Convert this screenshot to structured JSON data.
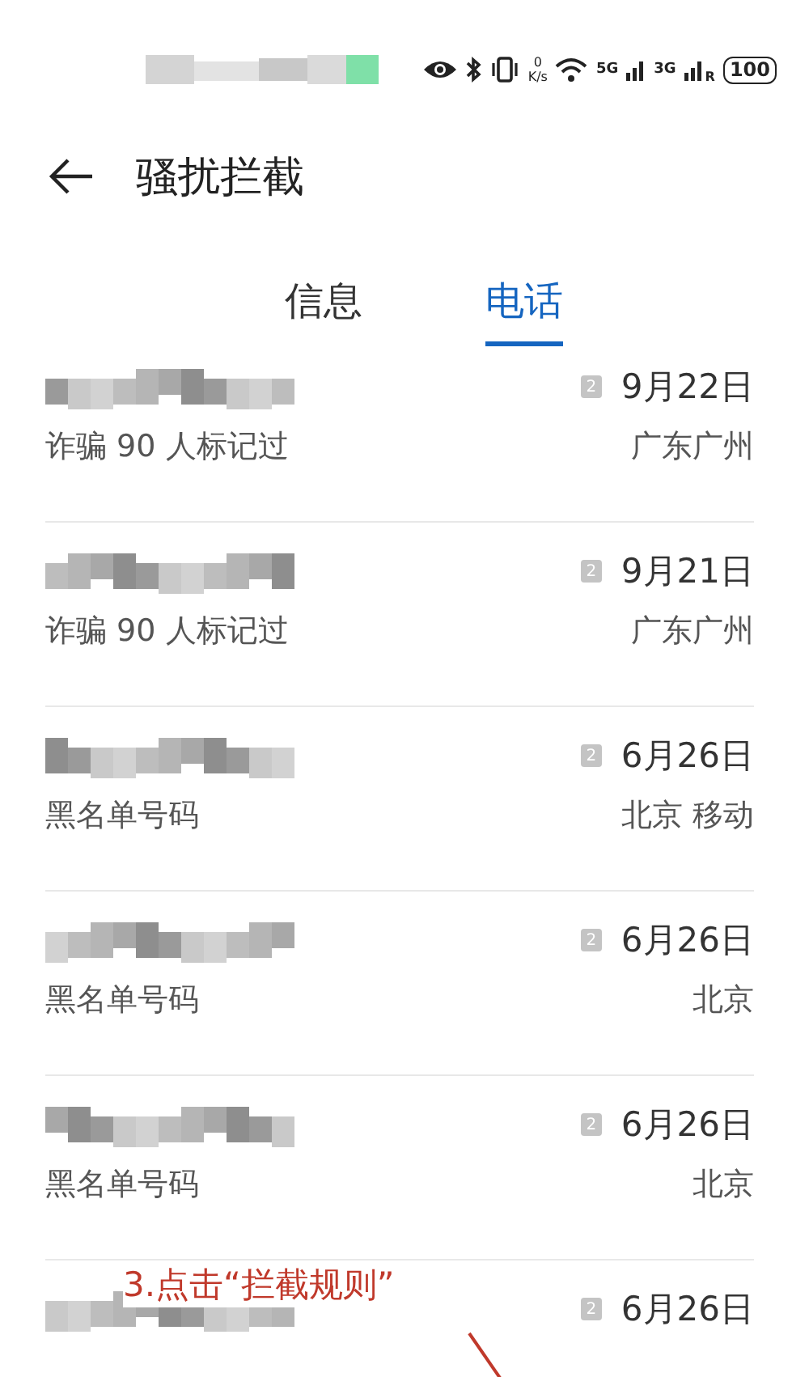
{
  "status_bar": {
    "speed_value": "0",
    "speed_unit": "K/s",
    "network_1": "5G",
    "network_2": "3G",
    "roaming": "R",
    "battery": "100"
  },
  "header": {
    "title": "骚扰拦截"
  },
  "tabs": [
    {
      "label": "信息",
      "selected": false
    },
    {
      "label": "电话",
      "selected": true
    }
  ],
  "calls": [
    {
      "sim": "2",
      "date": "9月22日",
      "label": "诈骗  90 人标记过",
      "location": "广东广州"
    },
    {
      "sim": "2",
      "date": "9月21日",
      "label": "诈骗  90 人标记过",
      "location": "广东广州"
    },
    {
      "sim": "2",
      "date": "6月26日",
      "label": "黑名单号码",
      "location": "北京 移动"
    },
    {
      "sim": "2",
      "date": "6月26日",
      "label": "黑名单号码",
      "location": "北京"
    },
    {
      "sim": "2",
      "date": "6月26日",
      "label": "黑名单号码",
      "location": "北京"
    },
    {
      "sim": "2",
      "date": "6月26日"
    }
  ],
  "annotation": {
    "text": "3.点击“拦截规则”"
  }
}
